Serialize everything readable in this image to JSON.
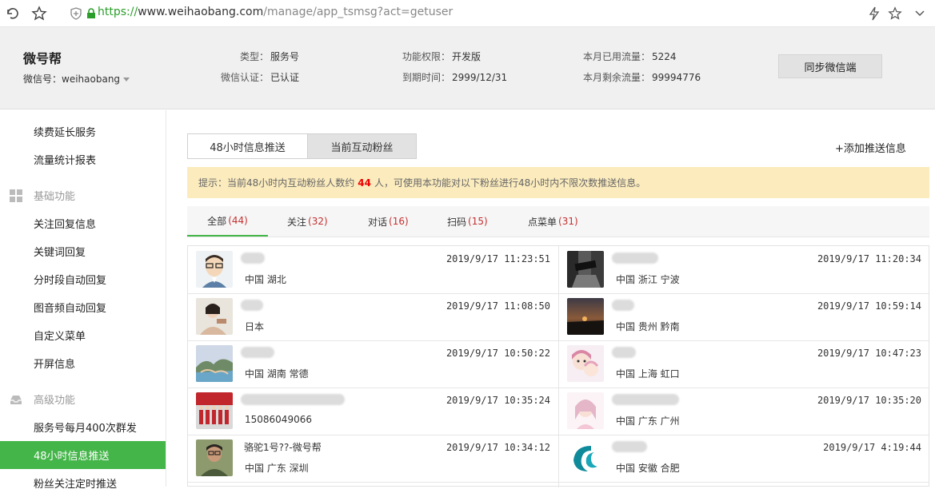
{
  "browser": {
    "url_scheme": "https://",
    "url_host": "www.weihaobang.com",
    "url_path": "/manage/app_tsmsg?act=getuser"
  },
  "account": {
    "name": "微号帮",
    "wechat_id_label": "微信号：",
    "wechat_id": "weihaobang",
    "type_label": "类型：",
    "type": "服务号",
    "verify_label": "微信认证：",
    "verify": "已认证",
    "perm_label": "功能权限：",
    "perm": "开发版",
    "expire_label": "到期时间：",
    "expire": "2999/12/31",
    "used_label": "本月已用流量：",
    "used": "5224",
    "left_label": "本月剩余流量：",
    "left": "99994776",
    "sync_button": "同步微信端"
  },
  "sidebar": {
    "items": [
      {
        "label": "续费延长服务"
      },
      {
        "label": "流量统计报表"
      },
      {
        "label": "基础功能",
        "group": true
      },
      {
        "label": "关注回复信息"
      },
      {
        "label": "关键词回复"
      },
      {
        "label": "分时段自动回复"
      },
      {
        "label": "图音频自动回复"
      },
      {
        "label": "自定义菜单"
      },
      {
        "label": "开屏信息"
      },
      {
        "label": "高级功能",
        "group": true
      },
      {
        "label": "服务号每月400次群发"
      },
      {
        "label": "48小时信息推送",
        "active": true
      },
      {
        "label": "粉丝关注定时推送"
      }
    ]
  },
  "main": {
    "tab_push": "48小时信息推送",
    "tab_fans": "当前互动粉丝",
    "add_push": "+添加推送信息",
    "notice_prefix": "提示：当前48小时内互动粉丝人数约",
    "notice_count": "44",
    "notice_suffix": "人，可使用本功能对以下粉丝进行48小时内不限次数推送信息。",
    "filters": [
      {
        "label": "全部",
        "count": "(44)"
      },
      {
        "label": "关注",
        "count": "(32)"
      },
      {
        "label": "对话",
        "count": "(16)"
      },
      {
        "label": "扫码",
        "count": "(15)"
      },
      {
        "label": "点菜单",
        "count": "(31)"
      }
    ],
    "fans": [
      {
        "nick": "",
        "loc": "中国 湖北",
        "time": "2019/9/17 11:23:51"
      },
      {
        "nick": "",
        "loc": "中国 浙江 宁波",
        "time": "2019/9/17 11:20:34"
      },
      {
        "nick": "",
        "loc": "日本",
        "time": "2019/9/17 11:08:50"
      },
      {
        "nick": "",
        "loc": "中国 贵州 黔南",
        "time": "2019/9/17 10:59:14"
      },
      {
        "nick": "",
        "loc": "中国 湖南 常德",
        "time": "2019/9/17 10:50:22"
      },
      {
        "nick": "",
        "loc": "中国 上海 虹口",
        "time": "2019/9/17 10:47:23"
      },
      {
        "nick": "",
        "loc": "15086049066",
        "time": "2019/9/17 10:35:24"
      },
      {
        "nick": "",
        "loc": "中国 广东 广州",
        "time": "2019/9/17 10:35:20"
      },
      {
        "nick": "骆驼1号??-微号帮",
        "loc": "中国 广东 深圳",
        "time": "2019/9/17 10:34:12"
      },
      {
        "nick": "",
        "loc": "中国 安徽 合肥",
        "time": "2019/9/17 4:19:44"
      }
    ]
  },
  "colors": {
    "accent": "#44b549",
    "notice_bg": "#fbebbd",
    "count_red": "#c53030"
  }
}
